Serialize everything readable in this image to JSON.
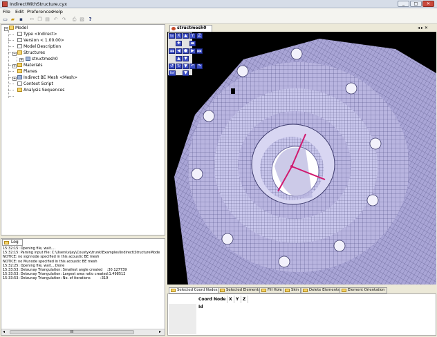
{
  "window": {
    "title": "IndirectWithStructure.cyx",
    "controls": [
      "_",
      "□",
      "✕"
    ]
  },
  "menu": [
    "File",
    "Edit",
    "Preferences",
    "Help"
  ],
  "toolbar_icons": [
    "new-icon",
    "open-icon",
    "save-icon",
    "cut-icon",
    "copy-icon",
    "paste-icon",
    "undo-icon",
    "redo-icon",
    "print-icon",
    "print-preview-icon",
    "help-icon"
  ],
  "tree": [
    {
      "label": "Model",
      "icon": "folder",
      "level": 0,
      "expander": "−"
    },
    {
      "label": "Type <Indirect>",
      "icon": "doc",
      "level": 1
    },
    {
      "label": "Version < 1.00.00>",
      "icon": "doc",
      "level": 1
    },
    {
      "label": "Model Description",
      "icon": "doc",
      "level": 1
    },
    {
      "label": "Structures",
      "icon": "folder",
      "level": 1,
      "expander": "−"
    },
    {
      "label": "structmesh0",
      "icon": "mesh",
      "level": 2,
      "expander": "+"
    },
    {
      "label": "Materials",
      "icon": "folder",
      "level": 1,
      "expander": "+"
    },
    {
      "label": "Planes",
      "icon": "folder",
      "level": 1
    },
    {
      "label": "Indirect BE Mesh <Mesh>",
      "icon": "mesh",
      "level": 1,
      "expander": "+"
    },
    {
      "label": "Context Script",
      "icon": "doc",
      "level": 1
    },
    {
      "label": "Analysis Sequences",
      "icon": "folder",
      "level": 1
    }
  ],
  "log": {
    "tab_label": "Log",
    "lines": [
      "15:32:15: Opening file, wait....",
      "15:32:15: Parsing input file: C:\\Users\\vijay\\Coustyx\\trunk\\Examples\\Indirect\\StructureMode",
      "NOTICE: no signnode specified in this acoustic BE mesh",
      "NOTICE: no Munode specified in this acoustic BE mesh",
      "15:32:25: Opening file, wait....Done",
      "15:33:53: Delaunay Triangulation: Smallest angle created    :30.127739",
      "15:33:53: Delaunay Triangulation: Largest area ratio created:1.498512",
      "15:33:53: Delaunay Triangulation: No. of iterations         :319"
    ],
    "scrollbar_mark": "III"
  },
  "viewer": {
    "tab_label": "structmesh0",
    "nav_arrows": "◂ ▸ ✕",
    "nav_buttons": [
      [
        "Iso",
        "X",
        "▲",
        "Y",
        "Z"
      ],
      [
        "",
        "✚",
        "",
        "▬",
        ""
      ],
      [
        "◀◀",
        "◀",
        "●",
        "▶",
        "▶▶"
      ],
      [
        "",
        "▲",
        "▼",
        "",
        ""
      ],
      [
        "↺",
        "↻",
        "▼",
        "↶",
        "↷"
      ],
      [
        "Ref",
        "",
        "▼",
        "",
        ""
      ]
    ]
  },
  "bottom_tabs": [
    "Selected Coord Nodes",
    "Selected Elements",
    "Fill Hole",
    "Skin",
    "Delete Elements",
    "Element Orientation"
  ],
  "table": {
    "columns": [
      "Coord Node Id",
      "X",
      "Y",
      "Z"
    ]
  },
  "colors": {
    "mesh_fill": "#b9b5e0",
    "mesh_line": "#3c3a6c",
    "axis_color": "#d0196e",
    "accent_blue": "#3d4fc7"
  }
}
